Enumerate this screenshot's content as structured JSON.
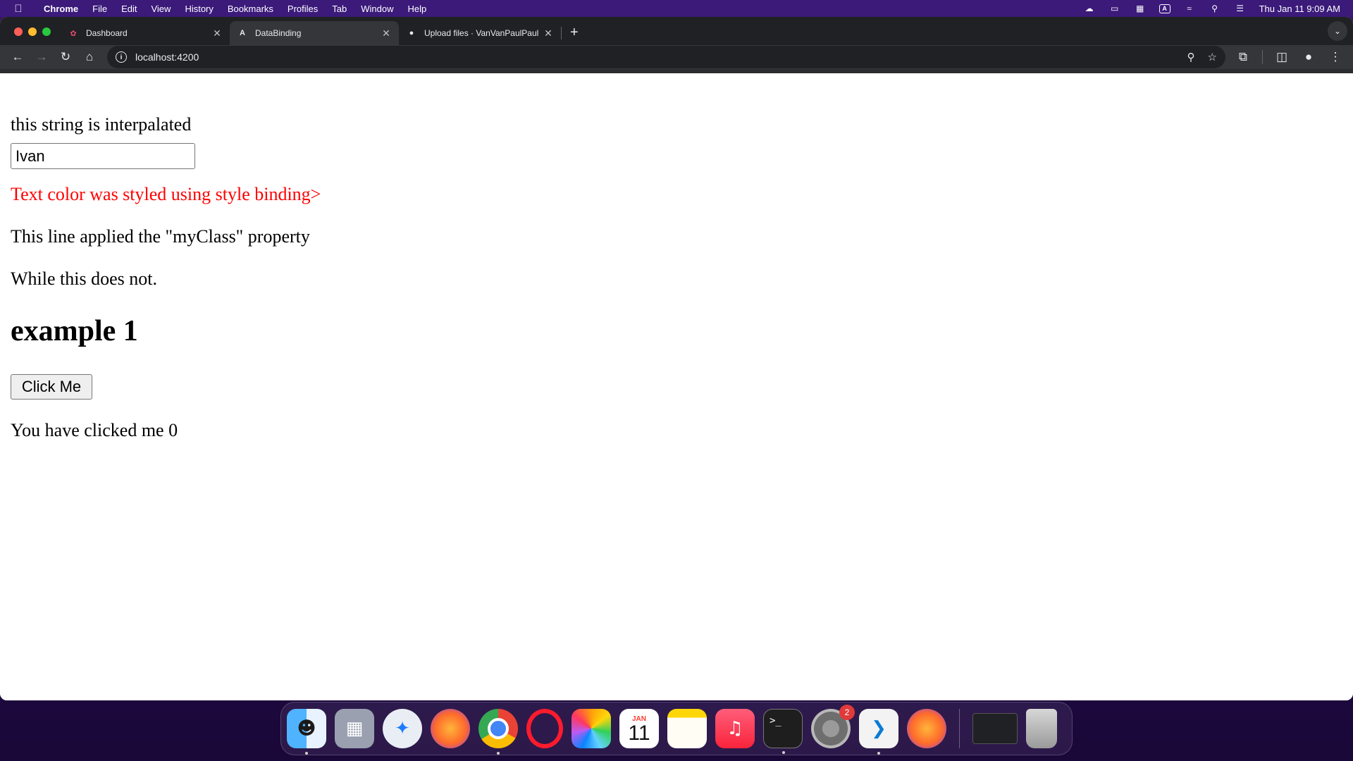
{
  "menubar": {
    "app_name": "Chrome",
    "items": [
      "File",
      "Edit",
      "View",
      "History",
      "Bookmarks",
      "Profiles",
      "Tab",
      "Window",
      "Help"
    ],
    "clock": "Thu Jan 11  9:09 AM"
  },
  "tabs": [
    {
      "title": "Dashboard",
      "active": false
    },
    {
      "title": "DataBinding",
      "active": true
    },
    {
      "title": "Upload files · VanVanPaulPaul",
      "active": false
    }
  ],
  "address_bar": {
    "url": "localhost:4200"
  },
  "page": {
    "interpolated_text": "this string is interpalated",
    "name_input_value": "Ivan",
    "styled_text": "Text color was styled using style binding>",
    "styled_color": "#ff0000",
    "class_applied_text": "This line applied the \"myClass\" property",
    "class_not_applied_text": "While this does not.",
    "heading": "example 1",
    "button_label": "Click Me",
    "click_counter_text": "You have clicked me 0"
  },
  "dock": {
    "calendar_month": "JAN",
    "calendar_day": "11",
    "settings_badge": "2"
  }
}
